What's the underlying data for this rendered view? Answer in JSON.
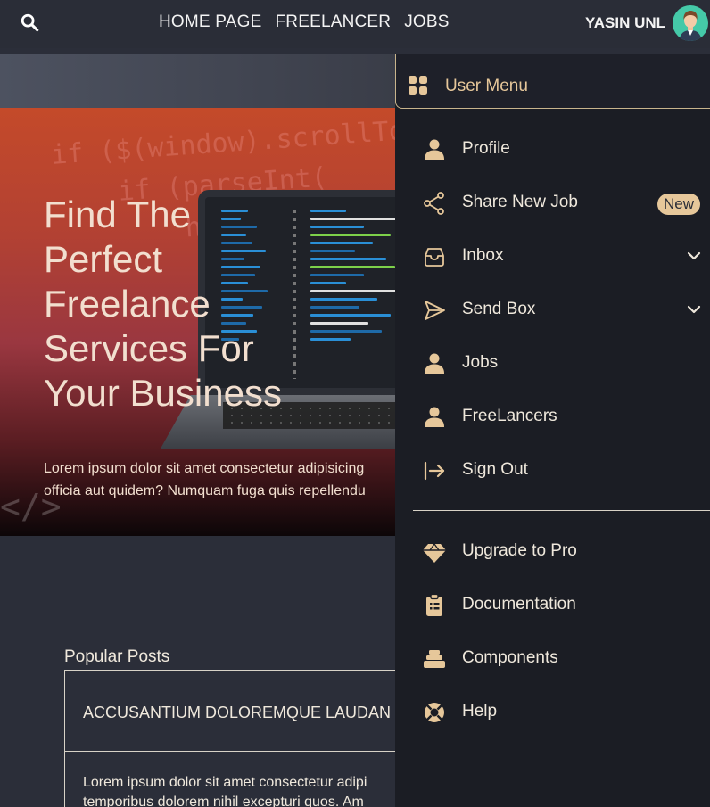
{
  "nav": {
    "links": [
      "HOME PAGE",
      "FREELANCER",
      "JOBS"
    ],
    "user_name": "YASIN UNL"
  },
  "hero": {
    "bg_code": "if ($(window).scrollTop()\n    if (parseInt(\n        header",
    "title": "Find The Perfect Freelance Services For Your Business",
    "text_line1": "Lorem ipsum dolor sit amet consectetur adipisicing",
    "text_line2": "officia aut quidem? Numquam fuga quis repellendu",
    "code_glyph": "</>"
  },
  "popular": {
    "title": "Popular Posts",
    "post_title": "ACCUSANTIUM DOLOREMQUE LAUDAN",
    "post_line1": "Lorem ipsum dolor sit amet consectetur adipi",
    "post_line2": "temporibus dolorem nihil excepturi quos. Am"
  },
  "menu": {
    "header": "User Menu",
    "items": [
      {
        "label": "Profile",
        "icon": "user-icon"
      },
      {
        "label": "Share New Job",
        "icon": "share-icon",
        "badge": "New"
      },
      {
        "label": "Inbox",
        "icon": "inbox-icon",
        "chevron": true
      },
      {
        "label": "Send Box",
        "icon": "send-icon",
        "chevron": true
      },
      {
        "label": "Jobs",
        "icon": "user-icon"
      },
      {
        "label": "FreeLancers",
        "icon": "user-icon"
      },
      {
        "label": "Sign Out",
        "icon": "sign-out-icon"
      }
    ],
    "secondary": [
      {
        "label": "Upgrade to Pro",
        "icon": "diamond-icon"
      },
      {
        "label": "Documentation",
        "icon": "clipboard-icon"
      },
      {
        "label": "Components",
        "icon": "layers-icon"
      },
      {
        "label": "Help",
        "icon": "lifebuoy-icon"
      }
    ]
  },
  "colors": {
    "accent": "#e6c79a",
    "panel": "#1b1d24",
    "navbar": "#2a2d37",
    "page": "#2b2e39"
  }
}
